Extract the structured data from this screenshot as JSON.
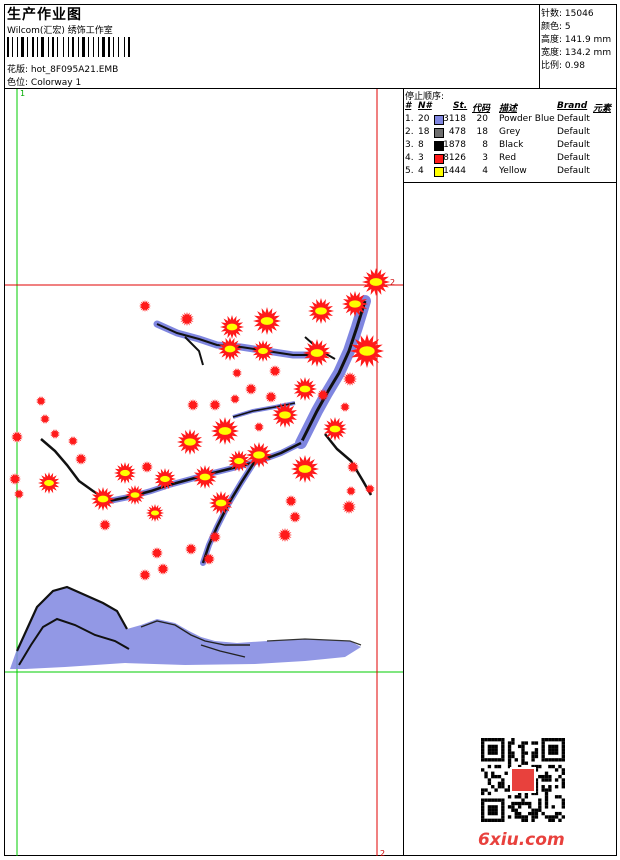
{
  "header": {
    "title": "生产作业图",
    "subtitle": "Wilcom(汇宏) 绣饰工作室",
    "design_label": "花版:",
    "design_name": "hot_8F095A21.EMB",
    "colorway_label": "色位:",
    "colorway_name": "Colorway 1"
  },
  "stats": [
    {
      "label": "针数:",
      "value": "15046"
    },
    {
      "label": "颜色:",
      "value": "5"
    },
    {
      "label": "高度:",
      "value": "141.9 mm"
    },
    {
      "label": "宽度:",
      "value": "134.2 mm"
    },
    {
      "label": "比例:",
      "value": "0.98"
    }
  ],
  "stop_sequence": {
    "title": "停止顺序:",
    "headers": {
      "num": "#",
      "n": "N#",
      "st": "St.",
      "code": "代码",
      "desc": "描述",
      "brand": "Brand",
      "element": "元素"
    },
    "rows": [
      {
        "num": "1.",
        "n": "20",
        "color": "#7f86e0",
        "st": "3118",
        "code": "20",
        "desc": "Powder Blue",
        "brand": "Default"
      },
      {
        "num": "2.",
        "n": "18",
        "color": "#6e6e6e",
        "st": "478",
        "code": "18",
        "desc": "Grey",
        "brand": "Default"
      },
      {
        "num": "3.",
        "n": "8",
        "color": "#000000",
        "st": "1878",
        "code": "8",
        "desc": "Black",
        "brand": "Default"
      },
      {
        "num": "4.",
        "n": "3",
        "color": "#ff1a1a",
        "st": "8126",
        "code": "3",
        "desc": "Red",
        "brand": "Default"
      },
      {
        "num": "5.",
        "n": "4",
        "color": "#ffff00",
        "st": "1444",
        "code": "4",
        "desc": "Yellow",
        "brand": "Default"
      }
    ]
  },
  "guides": {
    "label_1": "1",
    "label_2": "2"
  },
  "watermark": "6xiu.com",
  "colors": {
    "guide_green": "#00cc00",
    "guide_red": "#e00000",
    "blossom": "#ff1a1a",
    "stamen": "#ffff00",
    "branch": "#000000",
    "mountain": "#7f86e0"
  }
}
